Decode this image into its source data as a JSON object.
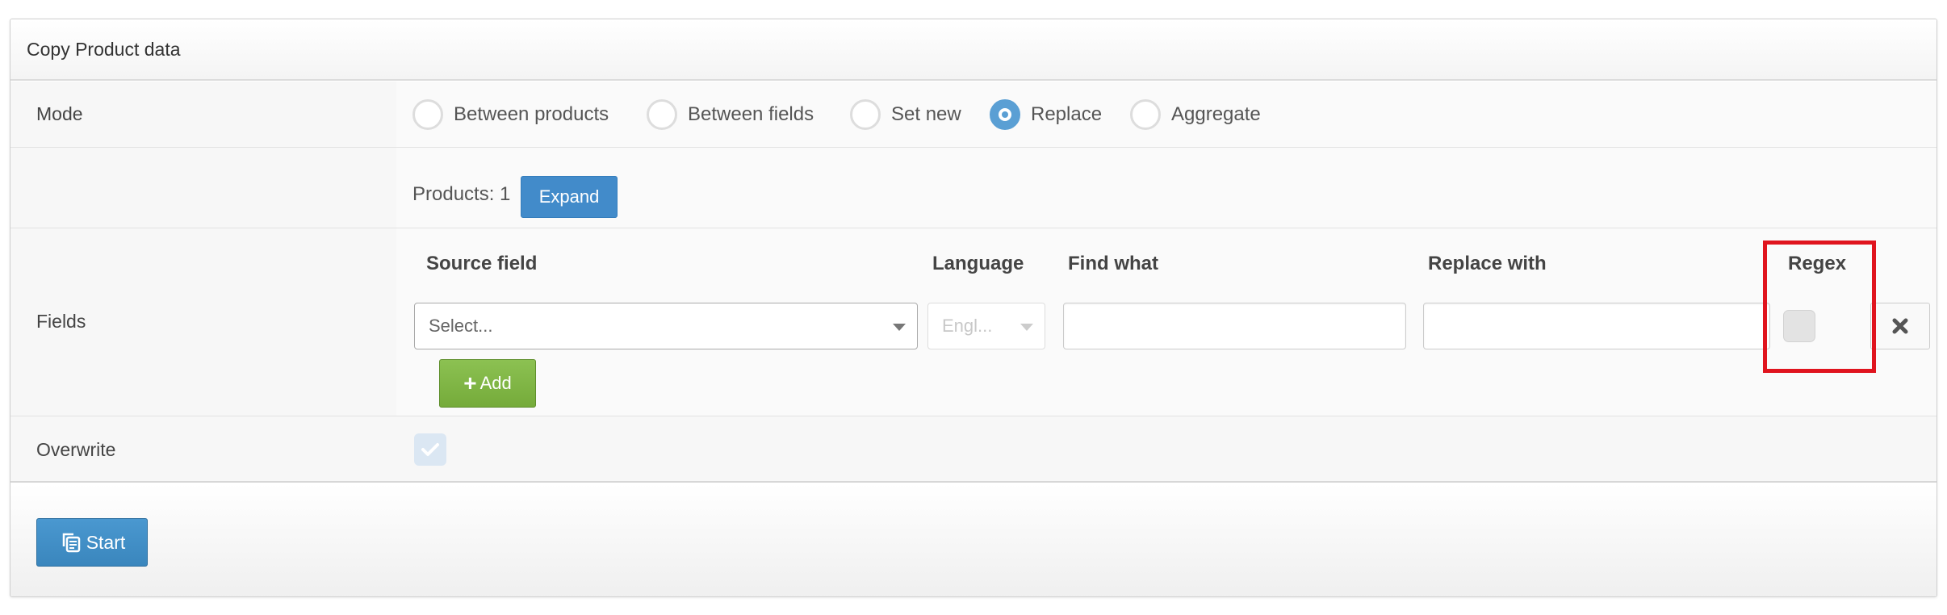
{
  "panel": {
    "title": "Copy Product data"
  },
  "mode": {
    "label": "Mode",
    "options": [
      {
        "label": "Between products",
        "checked": false
      },
      {
        "label": "Between fields",
        "checked": false
      },
      {
        "label": "Set new",
        "checked": false
      },
      {
        "label": "Replace",
        "checked": true
      },
      {
        "label": "Aggregate",
        "checked": false
      }
    ]
  },
  "products": {
    "text": "Products: 1",
    "expand_label": "Expand"
  },
  "fields": {
    "label": "Fields",
    "columns": {
      "source_field": "Source field",
      "language": "Language",
      "find_what": "Find what",
      "replace_with": "Replace with",
      "regex": "Regex"
    },
    "row": {
      "source_field_value": "Select...",
      "language_value": "Engl...",
      "language_disabled": true,
      "find_what_value": "",
      "replace_with_value": "",
      "regex_checked": false
    },
    "add_label": "Add"
  },
  "overwrite": {
    "label": "Overwrite",
    "checked": true
  },
  "footer": {
    "start_label": "Start"
  },
  "icons": {
    "remove": "close-icon",
    "add": "plus-icon",
    "start": "copy-icon",
    "overwrite": "checkmark-icon"
  },
  "colors": {
    "primary": "#428bca",
    "success": "#7ab03f",
    "radio_checked": "#5a9fd4",
    "highlight": "#e0141e"
  }
}
